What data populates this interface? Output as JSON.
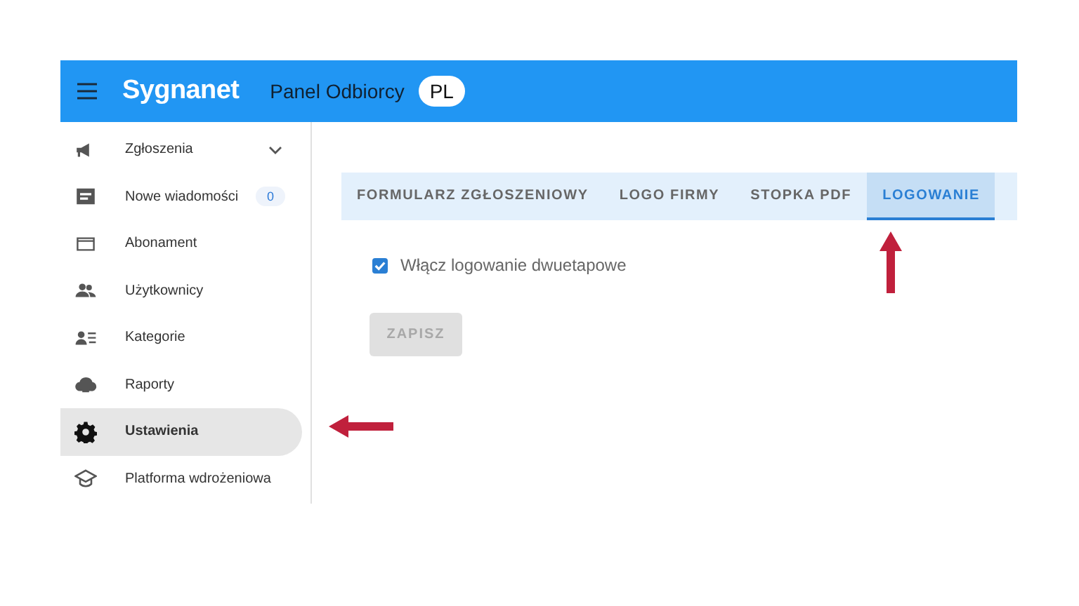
{
  "header": {
    "logo": "Sygnanet",
    "title": "Panel Odbiorcy",
    "language": "PL"
  },
  "sidebar": {
    "items": [
      {
        "label": "Zgłoszenia",
        "kind": "megaphone",
        "selected": false,
        "expanded": false
      },
      {
        "label": "Nowe wiadomości",
        "kind": "message",
        "selected": false,
        "badge": "0"
      },
      {
        "label": "Abonament",
        "kind": "card",
        "selected": false
      },
      {
        "label": "Użytkownicy",
        "kind": "people",
        "selected": false
      },
      {
        "label": "Kategorie",
        "kind": "category",
        "selected": false
      },
      {
        "label": "Raporty",
        "kind": "cloud",
        "selected": false
      },
      {
        "label": "Ustawienia",
        "kind": "gear",
        "selected": true
      },
      {
        "label": "Platforma wdrożeniowa",
        "kind": "school",
        "selected": false
      }
    ]
  },
  "tabs": [
    {
      "label": "FORMULARZ ZGŁOSZENIOWY",
      "selected": false
    },
    {
      "label": "LOGO FIRMY",
      "selected": false
    },
    {
      "label": "STOPKA PDF",
      "selected": false
    },
    {
      "label": "LOGOWANIE",
      "selected": true
    }
  ],
  "settings": {
    "checkbox": {
      "label": "Włącz logowanie dwuetapowe",
      "checked": true
    },
    "save_button": {
      "label": "ZAPISZ",
      "disabled": true
    }
  }
}
